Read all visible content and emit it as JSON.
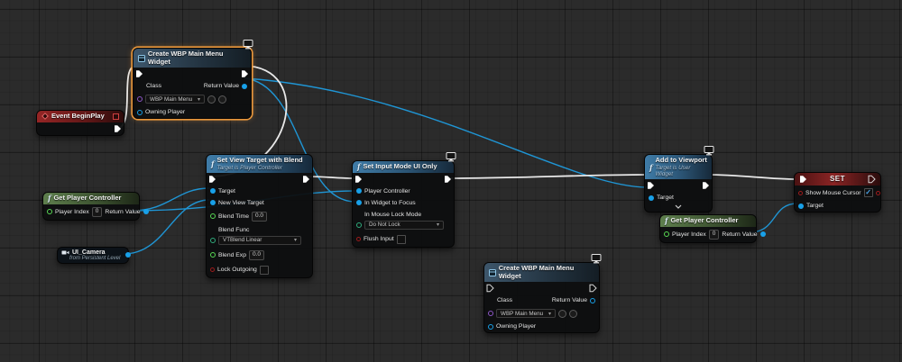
{
  "colors": {
    "background": "#2b2b2b",
    "exec_wire": "#e9e9e9",
    "data_wire": "#1f95d4",
    "selection_outline": "#e9973c",
    "object_pin": "#18a0e8",
    "class_pin": "#8d56c8",
    "float_pin": "#58d953",
    "enum_pin": "#2fae7d",
    "bool_pin": "#9c1b1b",
    "function_header": "#3f7ca8",
    "pure_function_header": "#5e7f4d",
    "event_header": "#962525",
    "set_header": "#8a2424"
  },
  "icons": {
    "check": "✓",
    "dropdown_arrow": "▾"
  },
  "nodes": {
    "event_begin_play": {
      "title": "Event BeginPlay"
    },
    "create_top": {
      "title": "Create WBP Main Menu Widget",
      "class_label": "Class",
      "class_value": "WBP Main Menu",
      "owning_player_label": "Owning Player",
      "return_value_label": "Return Value",
      "selected": true
    },
    "get_player_controller_left": {
      "title": "Get Player Controller",
      "player_index_label": "Player Index",
      "player_index_value": "0",
      "return_value_label": "Return Value"
    },
    "ui_camera": {
      "title": "UI_Camera",
      "subtitle": "from Persistent Level"
    },
    "set_view_target": {
      "title": "Set View Target with Blend",
      "subtitle": "Target is Player Controller",
      "target_label": "Target",
      "new_view_target_label": "New View Target",
      "blend_time_label": "Blend Time",
      "blend_time_value": "0.0",
      "blend_func_label": "Blend Func",
      "blend_func_value": "VTBlend Linear",
      "blend_exp_label": "Blend Exp",
      "blend_exp_value": "0.0",
      "lock_outgoing_label": "Lock Outgoing"
    },
    "set_input_mode": {
      "title": "Set Input Mode UI Only",
      "player_controller_label": "Player Controller",
      "in_widget_to_focus_label": "In Widget to Focus",
      "in_mouse_lock_mode_label": "In Mouse Lock Mode",
      "in_mouse_lock_mode_value": "Do Not Lock",
      "flush_input_label": "Flush Input"
    },
    "create_bottom": {
      "title": "Create WBP Main Menu Widget",
      "class_label": "Class",
      "class_value": "WBP Main Menu",
      "owning_player_label": "Owning Player",
      "return_value_label": "Return Value"
    },
    "add_to_viewport": {
      "title": "Add to Viewport",
      "subtitle": "Target is User Widget",
      "target_label": "Target"
    },
    "get_player_controller_right": {
      "title": "Get Player Controller",
      "player_index_label": "Player Index",
      "player_index_value": "0",
      "return_value_label": "Return Value"
    },
    "set_show_mouse": {
      "title": "SET",
      "show_mouse_cursor_label": "Show Mouse Cursor",
      "show_mouse_cursor_checked": true,
      "target_label": "Target"
    }
  },
  "wires": [
    {
      "type": "exec",
      "from": "event_begin_play.exec_out",
      "to": "create_top.exec_in"
    },
    {
      "type": "exec",
      "from": "create_top.exec_out",
      "to": "set_view_target.exec_in"
    },
    {
      "type": "exec",
      "from": "set_view_target.exec_out",
      "to": "set_input_mode.exec_in"
    },
    {
      "type": "exec",
      "from": "set_input_mode.exec_out",
      "to": "add_to_viewport.exec_in"
    },
    {
      "type": "exec",
      "from": "add_to_viewport.exec_out",
      "to": "set_show_mouse.exec_in"
    },
    {
      "type": "data",
      "from": "create_top.return_value",
      "to": "set_input_mode.in_widget_to_focus"
    },
    {
      "type": "data",
      "from": "create_top.return_value",
      "to": "add_to_viewport.target"
    },
    {
      "type": "data",
      "from": "get_player_controller_left.return_value",
      "to": "set_view_target.target"
    },
    {
      "type": "data",
      "from": "get_player_controller_left.return_value",
      "to": "set_input_mode.player_controller"
    },
    {
      "type": "data",
      "from": "ui_camera.output",
      "to": "set_view_target.new_view_target"
    },
    {
      "type": "data",
      "from": "get_player_controller_right.return_value",
      "to": "set_show_mouse.target"
    }
  ]
}
